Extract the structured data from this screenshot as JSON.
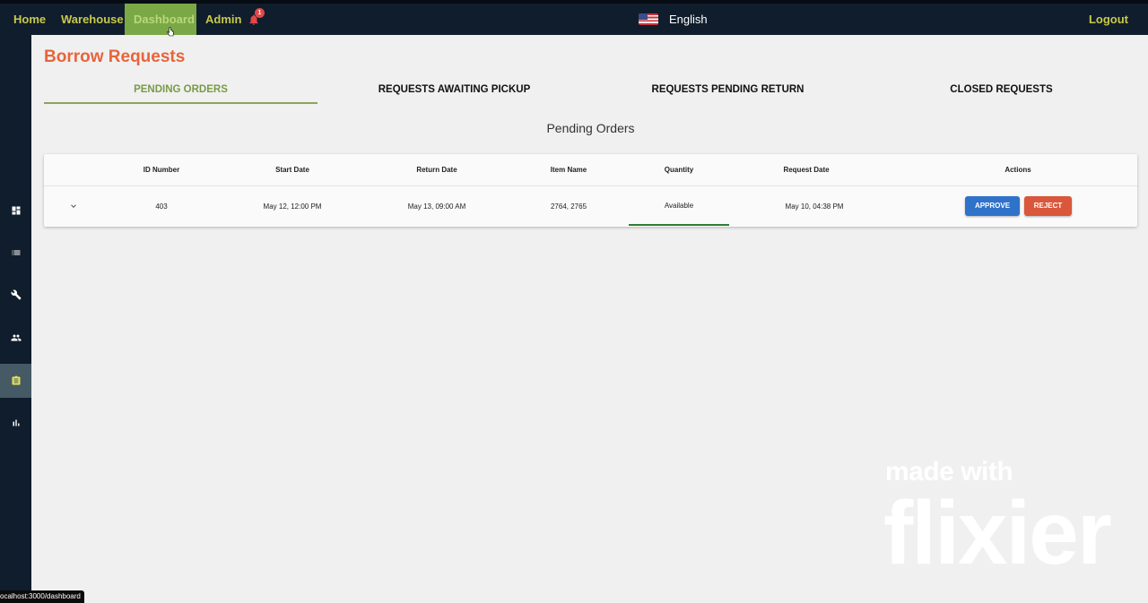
{
  "nav": {
    "items": [
      {
        "label": "Home"
      },
      {
        "label": "Warehouse"
      },
      {
        "label": "Dashboard"
      },
      {
        "label": "Admin"
      }
    ],
    "notification_count": "1",
    "language": "English",
    "logout_label": "Logout"
  },
  "sidebar": {
    "icons": [
      "dashboard-icon",
      "list-icon",
      "wrench-icon",
      "people-icon",
      "clipboard-icon",
      "bar-chart-icon"
    ],
    "active_index": 4
  },
  "page": {
    "title": "Borrow Requests",
    "tabs": [
      {
        "label": "PENDING ORDERS"
      },
      {
        "label": "REQUESTS AWAITING PICKUP"
      },
      {
        "label": "REQUESTS PENDING RETURN"
      },
      {
        "label": "CLOSED REQUESTS"
      }
    ],
    "subtitle": "Pending Orders"
  },
  "table": {
    "columns": [
      "ID Number",
      "Start Date",
      "Return Date",
      "Item Name",
      "Quantity",
      "Request Date",
      "Actions"
    ],
    "rows": [
      {
        "id": "403",
        "start_date": "May 12, 12:00 PM",
        "return_date": "May 13, 09:00 AM",
        "item_name": "2764, 2765",
        "quantity": "Available",
        "request_date": "May 10, 04:38 PM",
        "approve_label": "APPROVE",
        "reject_label": "REJECT"
      }
    ]
  },
  "watermark": {
    "line1": "made with",
    "line2": "flixier"
  },
  "status_url": "ocalhost:3000/dashboard",
  "colors": {
    "nav_bg": "#0f1d2c",
    "nav_text": "#c9c94a",
    "active_nav": "#7aa846",
    "title": "#e8643a",
    "approve": "#2f72c9",
    "reject": "#d9573a"
  }
}
